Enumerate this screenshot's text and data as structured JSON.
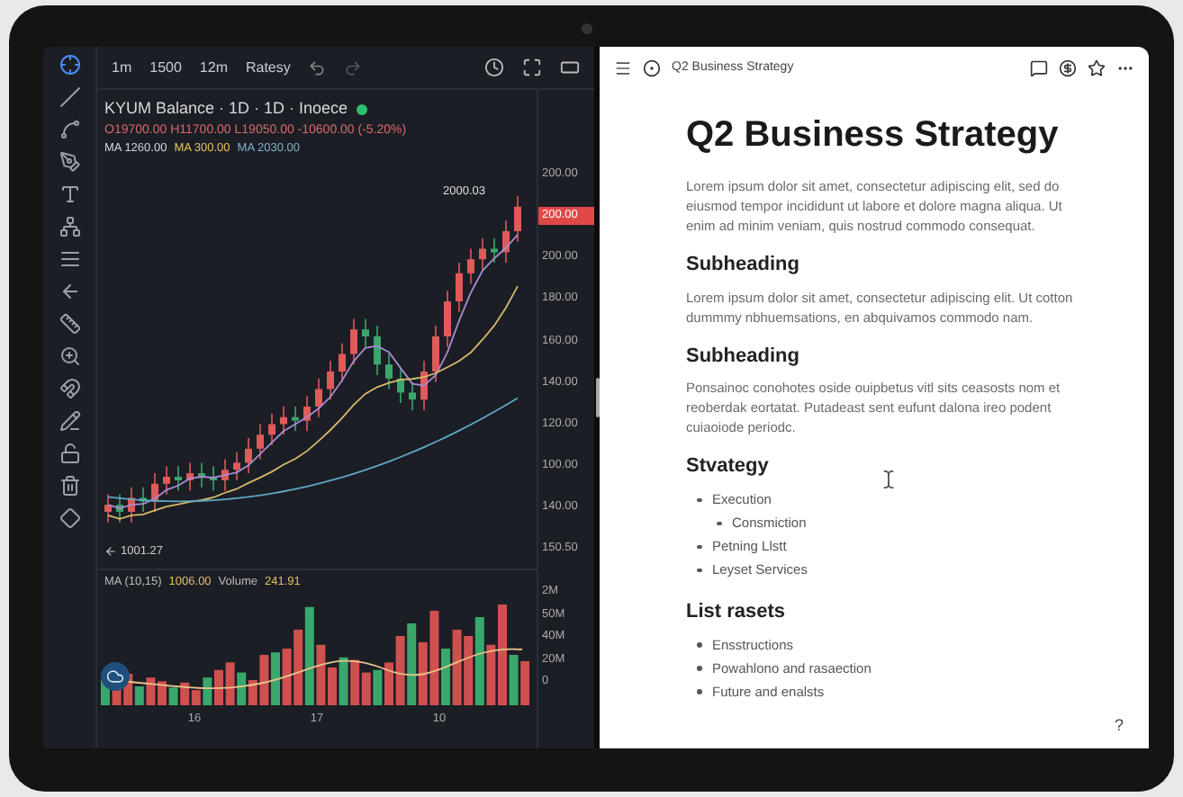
{
  "trading_app": {
    "timeframes": [
      "1m",
      "1500",
      "12m",
      "Ratesy"
    ],
    "symbol_title": "KYUM Balance · 1D · 1D · Inoece",
    "ohlc": "O19700.00 H11700.00 L19050.00 -10600.00 (-5.20%)",
    "ma_labels": [
      {
        "text": "MA 1260.00",
        "color": "#d1d5db"
      },
      {
        "text": "MA 300.00",
        "color": "#e8c35a"
      },
      {
        "text": "MA 2030.00",
        "color": "#7fb2c9"
      }
    ],
    "last_price_label": "2000.03",
    "price_axis": [
      "200.00",
      "200.00",
      "200.00",
      "180.00",
      "160.00",
      "140.00",
      "120.00",
      "100.00",
      "140.00",
      "150.50"
    ],
    "low_label": "1001.27",
    "volume_header": {
      "ma": "MA (10,15)",
      "ma_value": "1006.00",
      "volume_label": "Volume",
      "volume_value": "241.91"
    },
    "volume_axis": [
      "2M",
      "50M",
      "40M",
      "20M",
      "0"
    ],
    "x_axis": [
      "16",
      "17",
      "10"
    ]
  },
  "document": {
    "breadcrumb": "Q2 Business Strategy",
    "title": "Q2 Business Strategy",
    "blocks": [
      {
        "kind": "paragraph",
        "text": "Lorem ipsum dolor sit amet, consectetur adipiscing elit, sed do eiusmod tempor incididunt ut labore et dolore magna aliqua. Ut enim ad minim veniam, quis nostrud commodo consequat."
      },
      {
        "kind": "heading",
        "text": "Subheading"
      },
      {
        "kind": "paragraph",
        "text": "Lorem ipsum dolor sit amet, consectetur adipiscing elit. Ut cotton dummmy nbhuemsations, en abquivamos commodo nam."
      },
      {
        "kind": "heading",
        "text": "Subheading"
      },
      {
        "kind": "paragraph",
        "text": "Ponsainoc conohotes oside ouipbetus vitl sits ceasosts nom et reoberdak eortatat. Putadeast sent eufunt dalona ireo podent cuiaoiode periodc."
      },
      {
        "kind": "heading",
        "text": "Stvategy"
      },
      {
        "kind": "list",
        "items": [
          {
            "text": "Execution",
            "children": [
              {
                "text": "Consmiction"
              }
            ]
          },
          {
            "text": "Petning Llstt"
          },
          {
            "text": "Leyset Services"
          }
        ]
      },
      {
        "kind": "heading",
        "text": "List rasets"
      },
      {
        "kind": "list",
        "items": [
          {
            "text": "Ensstructions"
          },
          {
            "text": "Powahlono and rasaection"
          },
          {
            "text": "Future and enalsts"
          }
        ]
      }
    ],
    "help": "?"
  }
}
